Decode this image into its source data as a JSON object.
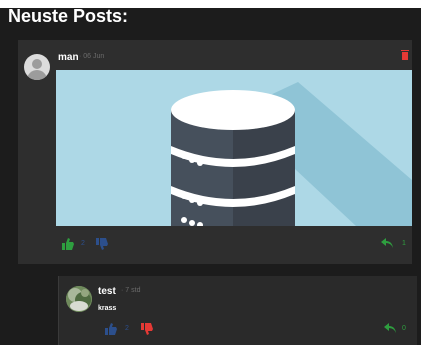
{
  "page": {
    "heading": "Neuste Posts:"
  },
  "post": {
    "author": "man",
    "date": "06 Jun",
    "image_alt": "database",
    "likes": "2",
    "replies": "1"
  },
  "comment": {
    "author": "test",
    "date": "7 std",
    "text": "krass",
    "likes": "2",
    "replies": "0"
  },
  "colors": {
    "background": "#1c1c1c",
    "card": "#2e2e2e",
    "image_bg": "#add8e6",
    "like_green": "#2e9e3f",
    "dislike_blue": "#2c4f8c",
    "dislike_red": "#e53935",
    "reply_green": "#2e9e3f"
  },
  "icons": [
    "avatar-placeholder-icon",
    "trash-icon",
    "thumbs-up-icon",
    "thumbs-down-icon",
    "reply-icon",
    "database-icon"
  ]
}
